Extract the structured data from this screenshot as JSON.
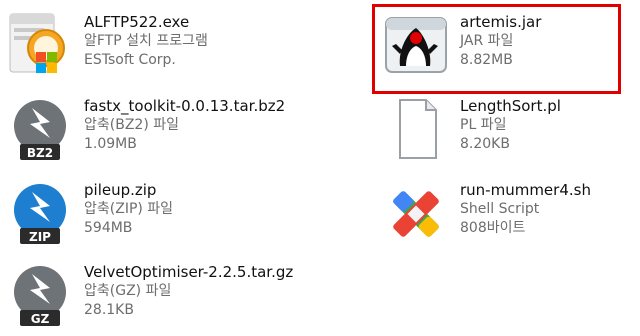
{
  "colors": {
    "selection_border": "#e00000",
    "archive_blue": "#1e7fd0",
    "archive_gray": "#6e7378",
    "badge_dark": "#2b2b2b"
  },
  "files": [
    {
      "icon": "installer-icon",
      "name": "ALFTP522.exe",
      "type": "알FTP 설치 프로그램",
      "detail": "ESTsoft Corp."
    },
    {
      "icon": "java-jar-icon",
      "name": "artemis.jar",
      "type": "JAR 파일",
      "detail": "8.82MB",
      "selected": true
    },
    {
      "icon": "bz2-archive-icon",
      "badge": "BZ2",
      "name": "fastx_toolkit-0.0.13.tar.bz2",
      "type": "압축(BZ2) 파일",
      "detail": "1.09MB"
    },
    {
      "icon": "blank-document-icon",
      "name": "LengthSort.pl",
      "type": "PL 파일",
      "detail": "8.20KB"
    },
    {
      "icon": "zip-archive-icon",
      "badge": "ZIP",
      "name": "pileup.zip",
      "type": "압축(ZIP) 파일",
      "detail": "594MB"
    },
    {
      "icon": "shell-script-icon",
      "name": "run-mummer4.sh",
      "type": "Shell Script",
      "detail": "808바이트"
    },
    {
      "icon": "gz-archive-icon",
      "badge": "GZ",
      "name": "VelvetOptimiser-2.2.5.tar.gz",
      "type": "압축(GZ) 파일",
      "detail": "28.1KB"
    }
  ]
}
